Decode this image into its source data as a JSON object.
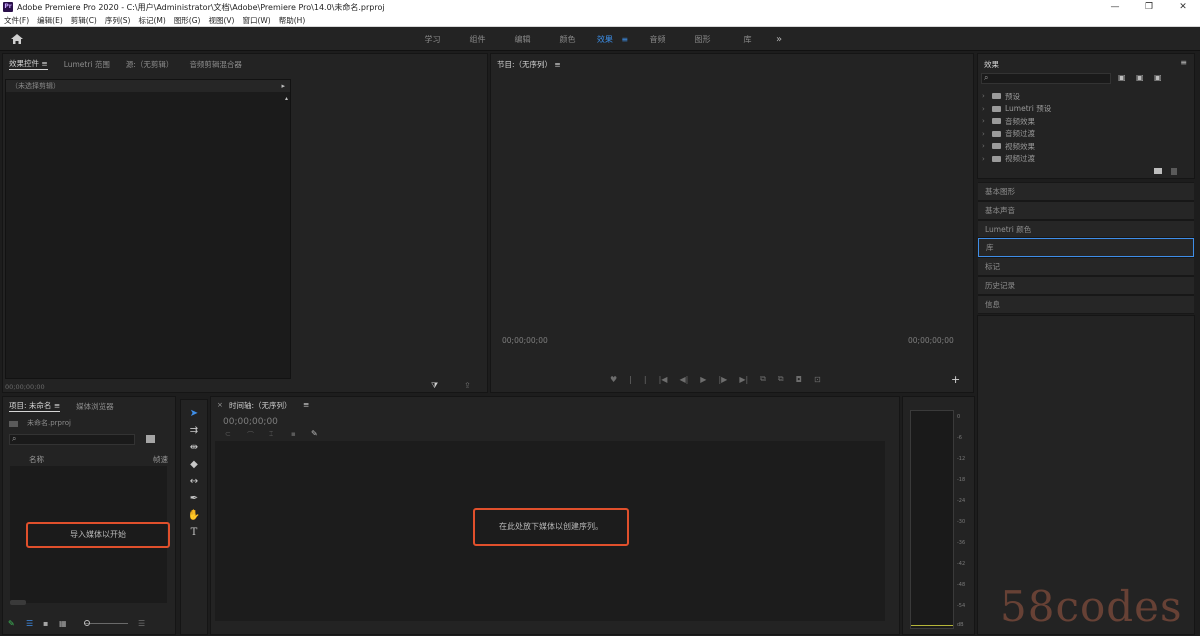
{
  "titlebar": {
    "app_icon_label": "Pr",
    "title": "Adobe Premiere Pro 2020 - C:\\用户\\Administrator\\文档\\Adobe\\Premiere Pro\\14.0\\未命名.prproj",
    "minimize": "—",
    "maximize": "❐",
    "close": "✕"
  },
  "menubar": {
    "items": [
      "文件(F)",
      "编辑(E)",
      "剪辑(C)",
      "序列(S)",
      "标记(M)",
      "图形(G)",
      "视图(V)",
      "窗口(W)",
      "帮助(H)"
    ]
  },
  "workspaces": {
    "tabs": [
      "学习",
      "组件",
      "编辑",
      "颜色",
      "效果",
      "音频",
      "图形",
      "库"
    ],
    "active": "效果",
    "more": "»",
    "menu": "≡"
  },
  "effect_controls": {
    "tabs": [
      "效果控件",
      "Lumetri 范围",
      "源:（无剪辑）",
      "音频剪辑混合器"
    ],
    "menu": "≡",
    "header": "（未选择剪辑）",
    "timecode": "00;00;00;00"
  },
  "program_monitor": {
    "title": "节目:（无序列）",
    "menu": "≡",
    "timecode_left": "00;00;00;00",
    "timecode_right": "00;00;00;00",
    "transport": [
      "♥",
      "|",
      "|",
      "|◀",
      "◀|",
      "▶",
      "|▶",
      "▶|",
      "⧉",
      "⧉",
      "◘",
      "⊡"
    ],
    "add": "+"
  },
  "effects_panel": {
    "title": "效果",
    "menu": "≡",
    "search_placeholder": "",
    "items": [
      "预设",
      "Lumetri 预设",
      "音频效果",
      "音频过渡",
      "视频效果",
      "视频过渡"
    ],
    "chevron": "›"
  },
  "side_panels": {
    "rows": [
      "基本图形",
      "基本声音",
      "Lumetri 颜色",
      "库",
      "标记",
      "历史记录",
      "信息"
    ],
    "selected": "库"
  },
  "project": {
    "tabs": [
      "项目: 未命名",
      "媒体浏览器"
    ],
    "menu": "≡",
    "file": "未命名.prproj",
    "columns": [
      "名称",
      "帧速"
    ],
    "import_hint": "导入媒体以开始"
  },
  "timeline": {
    "close": "×",
    "title": "时间轴:（无序列）",
    "menu": "≡",
    "timecode": "00;00;00;00",
    "drop_hint": "在此处放下媒体以创建序列。"
  },
  "meter": {
    "scale": [
      "0",
      "-6",
      "-12",
      "-18",
      "-24",
      "-30",
      "-36",
      "-42",
      "-48",
      "-54",
      "dB"
    ]
  },
  "watermark": "58codes"
}
